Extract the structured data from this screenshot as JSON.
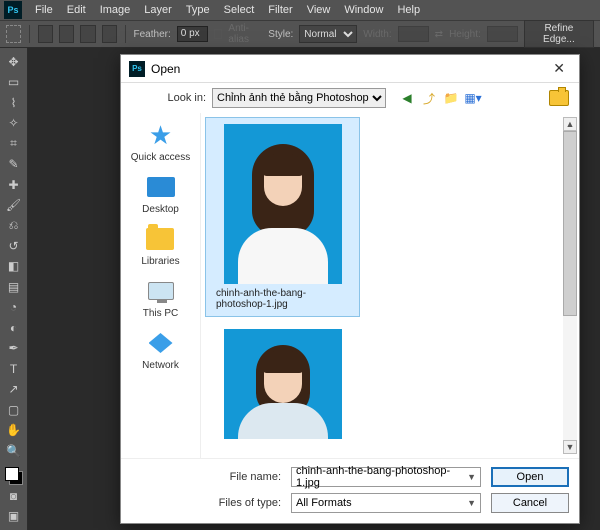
{
  "menubar": {
    "items": [
      "File",
      "Edit",
      "Image",
      "Layer",
      "Type",
      "Select",
      "Filter",
      "View",
      "Window",
      "Help"
    ]
  },
  "optbar": {
    "feather_label": "Feather:",
    "feather_value": "0 px",
    "antialias_label": "Anti-alias",
    "style_label": "Style:",
    "style_value": "Normal",
    "width_label": "Width:",
    "height_label": "Height:",
    "refine_label": "Refine Edge..."
  },
  "dialog": {
    "title": "Open",
    "lookin_label": "Look in:",
    "lookin_value": "Chỉnh ảnh thẻ bằng Photoshop",
    "places": [
      "Quick access",
      "Desktop",
      "Libraries",
      "This PC",
      "Network"
    ],
    "file1_caption": "chinh-anh-the-bang-photoshop-1.jpg",
    "filename_label": "File name:",
    "filename_value": "chinh-anh-the-bang-photoshop-1.jpg",
    "filesof_label": "Files of type:",
    "filesof_value": "All Formats",
    "open_btn": "Open",
    "cancel_btn": "Cancel"
  }
}
